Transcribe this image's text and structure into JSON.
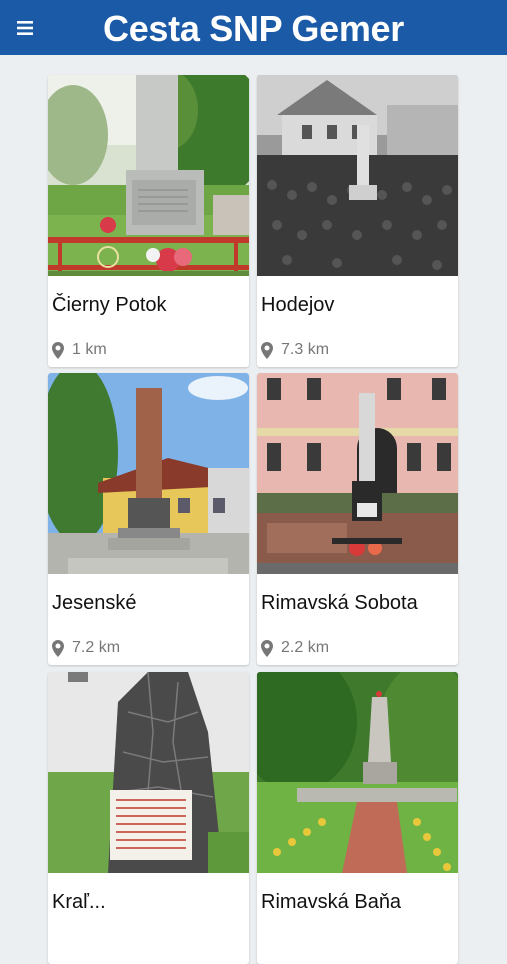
{
  "header": {
    "title": "Cesta SNP Gemer",
    "menu_icon": "hamburger-menu-icon",
    "color": "#1b5aa6"
  },
  "places": [
    {
      "name": "Čierny Potok",
      "distance": "1 km"
    },
    {
      "name": "Hodejov",
      "distance": "7.3 km"
    },
    {
      "name": "Jesenské",
      "distance": "7.2 km"
    },
    {
      "name": "Rimavská Sobota",
      "distance": "2.2 km"
    },
    {
      "name": "Kraľ...",
      "distance": ""
    },
    {
      "name": "Rimavská Baňa",
      "distance": ""
    }
  ],
  "location_icon": "map-pin-icon"
}
